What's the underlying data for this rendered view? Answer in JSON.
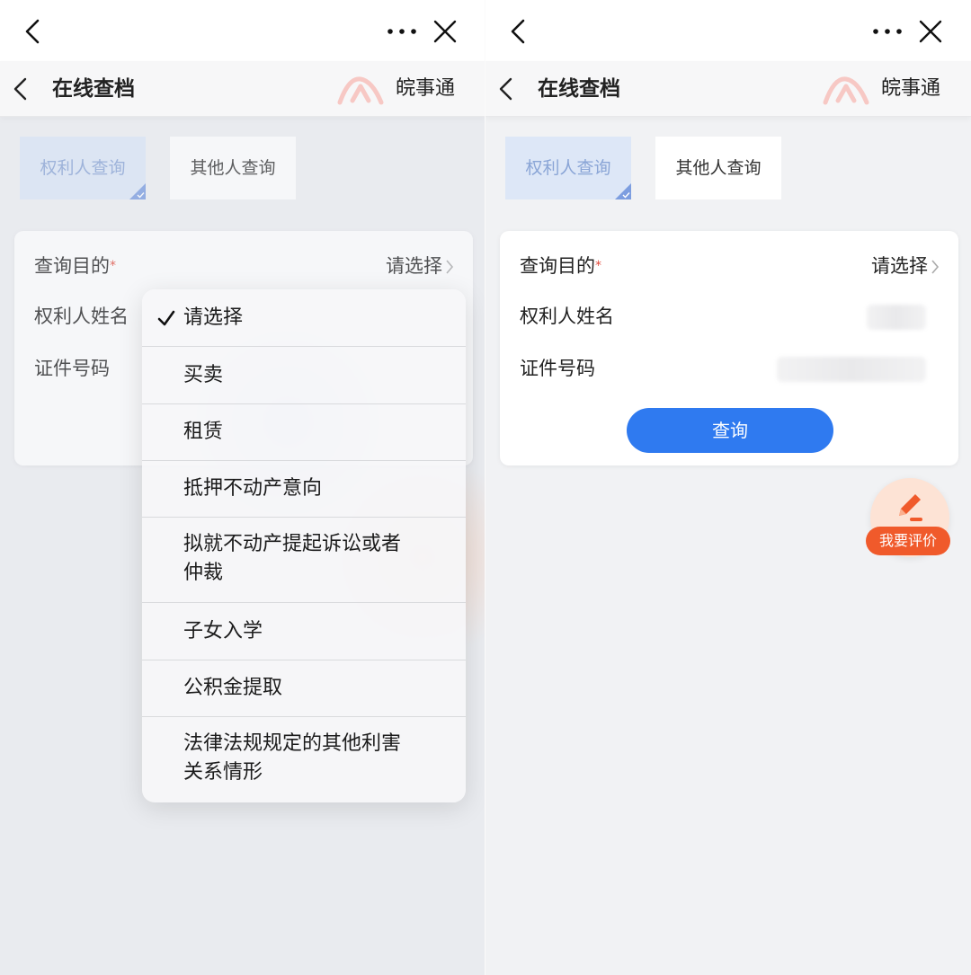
{
  "left_screen": {
    "app_title": "在线查档",
    "brand": "皖事通",
    "tabs": {
      "active_label": "权利人查询",
      "inactive_label": "其他人查询"
    },
    "form": {
      "purpose_label": "查询目的",
      "required_mark": "*",
      "purpose_value": "请选择",
      "owner_name_label": "权利人姓名",
      "id_number_label": "证件号码"
    },
    "dropdown": {
      "selected_index": 0,
      "options": [
        "请选择",
        "买卖",
        "租赁",
        "抵押不动产意向",
        "拟就不动产提起诉讼或者仲裁",
        "子女入学",
        "公积金提取",
        "法律法规规定的其他利害关系情形"
      ],
      "option_lines": {
        "opt4_line1": "拟就不动产提起诉讼或者",
        "opt4_line2": "仲裁",
        "opt7_line1": "法律法规规定的其他利害",
        "opt7_line2": "关系情形"
      }
    }
  },
  "right_screen": {
    "app_title": "在线查档",
    "brand": "皖事通",
    "tabs": {
      "active_label": "权利人查询",
      "inactive_label": "其他人查询"
    },
    "form": {
      "purpose_label": "查询目的",
      "required_mark": "*",
      "purpose_value": "请选择",
      "owner_name_label": "权利人姓名",
      "id_number_label": "证件号码",
      "query_button": "查询"
    },
    "feedback": {
      "label": "我要评价"
    }
  },
  "icons": {
    "back": "chevron-left-icon",
    "more": "more-dots-icon",
    "close": "close-icon",
    "logo": "brand-logo-icon",
    "check": "checkmark-icon",
    "chevron": "chevron-right-icon",
    "edit": "pencil-edit-icon"
  },
  "colors": {
    "primary": "#2f7af0",
    "active_tab_bg": "#dde7f7",
    "active_tab_text": "#8aa5d6",
    "required": "#e24a3b",
    "feedback_bg": "#f05a2b",
    "feedback_circle": "#fde3d5"
  }
}
